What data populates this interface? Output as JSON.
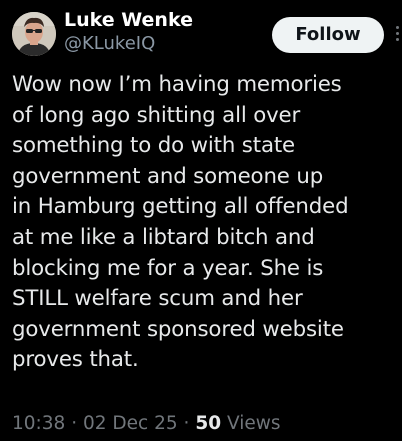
{
  "user": {
    "display_name": "Luke Wenke",
    "handle": "@KLukeIQ"
  },
  "follow_label": "Follow",
  "post": {
    "lines": [
      "Wow now I’m having memories",
      "of long ago shitting all over",
      "something to do with state",
      "government and someone up",
      "in Hamburg getting all offended",
      "at me like a libtard bitch and",
      "blocking me for a year.  She is",
      "STILL welfare scum and her",
      "government sponsored website",
      "proves that."
    ]
  },
  "meta": {
    "time": "10:38",
    "separator": "·",
    "date": "02 Dec 25",
    "views_count": "50",
    "views_label": "Views"
  },
  "icons": {
    "avatar": "avatar-photo",
    "more": "more-dots-icon"
  },
  "colors": {
    "background": "#000000",
    "text_primary": "#e7e9ea",
    "text_secondary": "#71767b",
    "follow_bg": "#eff3f4",
    "follow_text": "#0f1419"
  }
}
